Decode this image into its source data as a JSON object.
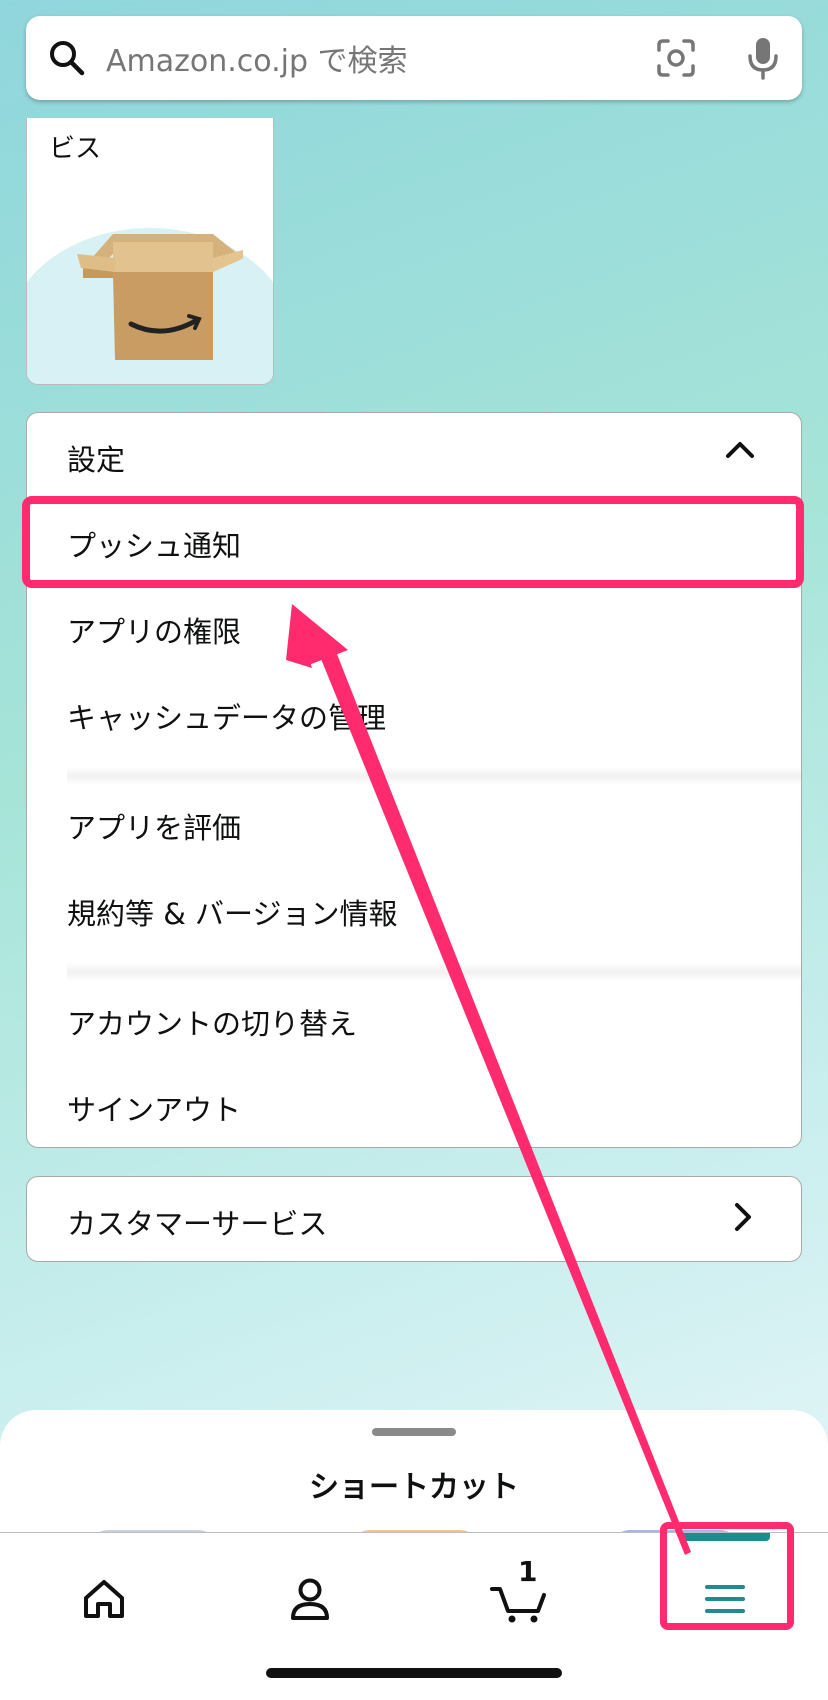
{
  "search": {
    "placeholder": "Amazon.co.jp で検索"
  },
  "promo_card": {
    "label": "ビス"
  },
  "settings": {
    "title": "設定",
    "items": [
      "プッシュ通知",
      "アプリの権限",
      "キャッシュデータの管理",
      "アプリを評価",
      "規約等 & バージョン情報",
      "アカウントの切り替え",
      "サインアウト"
    ]
  },
  "customer_service": {
    "label": "カスタマーサービス"
  },
  "shortcut_sheet": {
    "title": "ショートカット"
  },
  "tabbar": {
    "cart_count": "1"
  },
  "colors": {
    "highlight": "#ff2b6e",
    "accent": "#1c8c8f"
  }
}
